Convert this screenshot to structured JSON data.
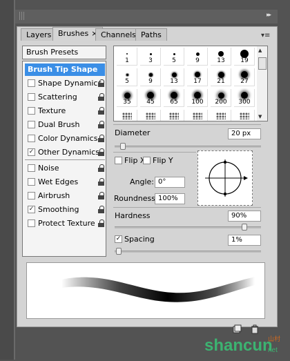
{
  "window": {
    "collapse_glyph": "▸▸"
  },
  "tabs": [
    {
      "label": "Layers"
    },
    {
      "label": "Brushes",
      "close": "×"
    },
    {
      "label": "Channels"
    },
    {
      "label": "Paths"
    }
  ],
  "panel_menu_glyph": "▾≡",
  "presets_label": "Brush Presets",
  "options": [
    {
      "label": "Brush Tip Shape",
      "selected": true,
      "checked": false,
      "lock": false
    },
    {
      "label": "Shape Dynamics",
      "checked": false,
      "lock": true
    },
    {
      "label": "Scattering",
      "checked": false,
      "lock": true
    },
    {
      "label": "Texture",
      "checked": false,
      "lock": true
    },
    {
      "label": "Dual Brush",
      "checked": false,
      "lock": true
    },
    {
      "label": "Color Dynamics",
      "checked": false,
      "lock": true
    },
    {
      "label": "Other Dynamics",
      "checked": true,
      "lock": true
    },
    {
      "label": "Noise",
      "checked": false,
      "lock": true
    },
    {
      "label": "Wet Edges",
      "checked": false,
      "lock": true
    },
    {
      "label": "Airbrush",
      "checked": false,
      "lock": true
    },
    {
      "label": "Smoothing",
      "checked": true,
      "lock": true
    },
    {
      "label": "Protect Texture",
      "checked": false,
      "lock": true
    }
  ],
  "check_glyph": "✓",
  "brush_tips": [
    "1",
    "3",
    "5",
    "9",
    "13",
    "19",
    "5",
    "9",
    "13",
    "17",
    "21",
    "27",
    "35",
    "45",
    "65",
    "100",
    "200",
    "300"
  ],
  "diameter": {
    "label": "Diameter",
    "value": "20 px",
    "level_pct": 4
  },
  "flip_x": {
    "label": "Flip X",
    "checked": false
  },
  "flip_y": {
    "label": "Flip Y",
    "checked": false
  },
  "angle": {
    "label": "Angle:",
    "value": "0°"
  },
  "roundness": {
    "label": "Roundness:",
    "value": "100%"
  },
  "hardness": {
    "label": "Hardness",
    "value": "90%",
    "level_pct": 90
  },
  "spacing": {
    "label": "Spacing",
    "checked": true,
    "value": "1%",
    "level_pct": 1
  },
  "watermark": {
    "text": "shancun",
    "suffix": "net",
    "sub": "山村"
  }
}
